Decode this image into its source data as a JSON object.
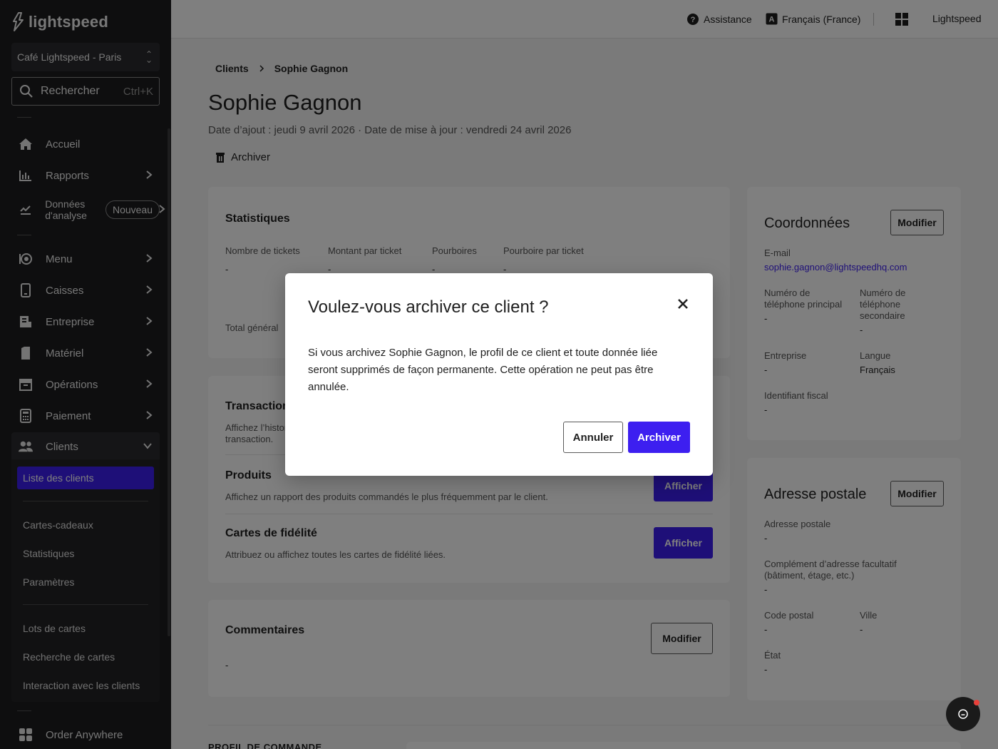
{
  "sidebar": {
    "logo": "lightspeed",
    "store": "Café Lightspeed - Paris",
    "search": {
      "label": "Rechercher",
      "shortcut": "Ctrl+K"
    },
    "nav": {
      "accueil": "Accueil",
      "rapports": "Rapports",
      "donnees_line1": "Données",
      "donnees_line2": "d'analyse",
      "nouveau": "Nouveau",
      "menu": "Menu",
      "caisses": "Caisses",
      "entreprise": "Entreprise",
      "materiel": "Matériel",
      "operations": "Opérations",
      "paiement": "Paiement",
      "clients": "Clients",
      "order_anywhere": "Order Anywhere"
    },
    "clients_sub": {
      "liste": "Liste des clients",
      "cartes_cadeaux": "Cartes-cadeaux",
      "statistiques": "Statistiques",
      "parametres": "Paramètres",
      "lots": "Lots de cartes",
      "recherche": "Recherche de cartes",
      "interaction": "Interaction avec les clients"
    }
  },
  "topbar": {
    "assistance": "Assistance",
    "language": "Français (France)",
    "account": "Lightspeed"
  },
  "page": {
    "breadcrumb_parent": "Clients",
    "breadcrumb_current": "Sophie Gagnon",
    "title": "Sophie Gagnon",
    "meta": "Date d’ajout : jeudi 9 avril 2026 · Date de mise à jour : vendredi 24 avril 2026",
    "archive_action": "Archiver"
  },
  "stats_card": {
    "title": "Statistiques",
    "col1": "Nombre de tickets",
    "col2": "Montant par ticket",
    "col3": "Pourboires",
    "col4": "Pourboire par ticket",
    "dash": "-",
    "total": "Total général"
  },
  "history_card": {
    "transactions_title": "Transactions",
    "transactions_desc_1": "Affichez l’historique",
    "transactions_desc_2": "transaction.",
    "products_title": "Produits",
    "products_desc": "Affichez un rapport des produits commandés le plus fréquemment par le client.",
    "loyalty_title": "Cartes de fidélité",
    "loyalty_desc": "Attribuez ou affichez toutes les cartes de fidélité liées.",
    "view_button": "Afficher"
  },
  "comments_card": {
    "title": "Commentaires",
    "edit": "Modifier",
    "value": "-"
  },
  "profile_heading": "PROFIL DE COMMANDE",
  "contact_card": {
    "title": "Coordonnées",
    "edit": "Modifier",
    "email_label": "E-mail",
    "email": "sophie.gagnon@lightspeedhq.com",
    "phone1_label_1": "Numéro de",
    "phone1_label_2": "téléphone principal",
    "phone2_label_1": "Numéro de",
    "phone2_label_2": "téléphone",
    "phone2_label_3": "secondaire",
    "company_label": "Entreprise",
    "language_label": "Langue",
    "language_value": "Français",
    "tax_label": "Identifiant fiscal",
    "dash": "-"
  },
  "address_card": {
    "title": "Adresse postale",
    "edit": "Modifier",
    "address_label": "Adresse postale",
    "complement_label_1": "Complément d’adresse facultatif",
    "complement_label_2": "(bâtiment, étage, etc.)",
    "postal_label": "Code postal",
    "city_label": "Ville",
    "state_label": "État",
    "dash": "-"
  },
  "modal": {
    "title": "Voulez-vous archiver ce client ?",
    "body": "Si vous archivez Sophie Gagnon, le profil de ce client et toute donnée liée seront supprimés de façon permanente. Cette opération ne peut pas être annulée.",
    "cancel": "Annuler",
    "confirm": "Archiver"
  },
  "colors": {
    "accent": "#3d1ff0",
    "sidebar_bg": "#1c1c1e",
    "notification_dot": "#e8403a"
  },
  "icons": [
    "home-icon",
    "chart-bar-icon",
    "analytics-icon",
    "menu-book-icon",
    "tablet-icon",
    "building-icon",
    "device-icon",
    "box-icon",
    "calculator-icon",
    "users-icon",
    "grid-icon",
    "search-icon",
    "help-icon",
    "language-icon",
    "apps-icon",
    "trash-icon",
    "close-icon",
    "chat-icon",
    "chevron-right-icon",
    "chevron-down-icon",
    "updown-icon"
  ]
}
